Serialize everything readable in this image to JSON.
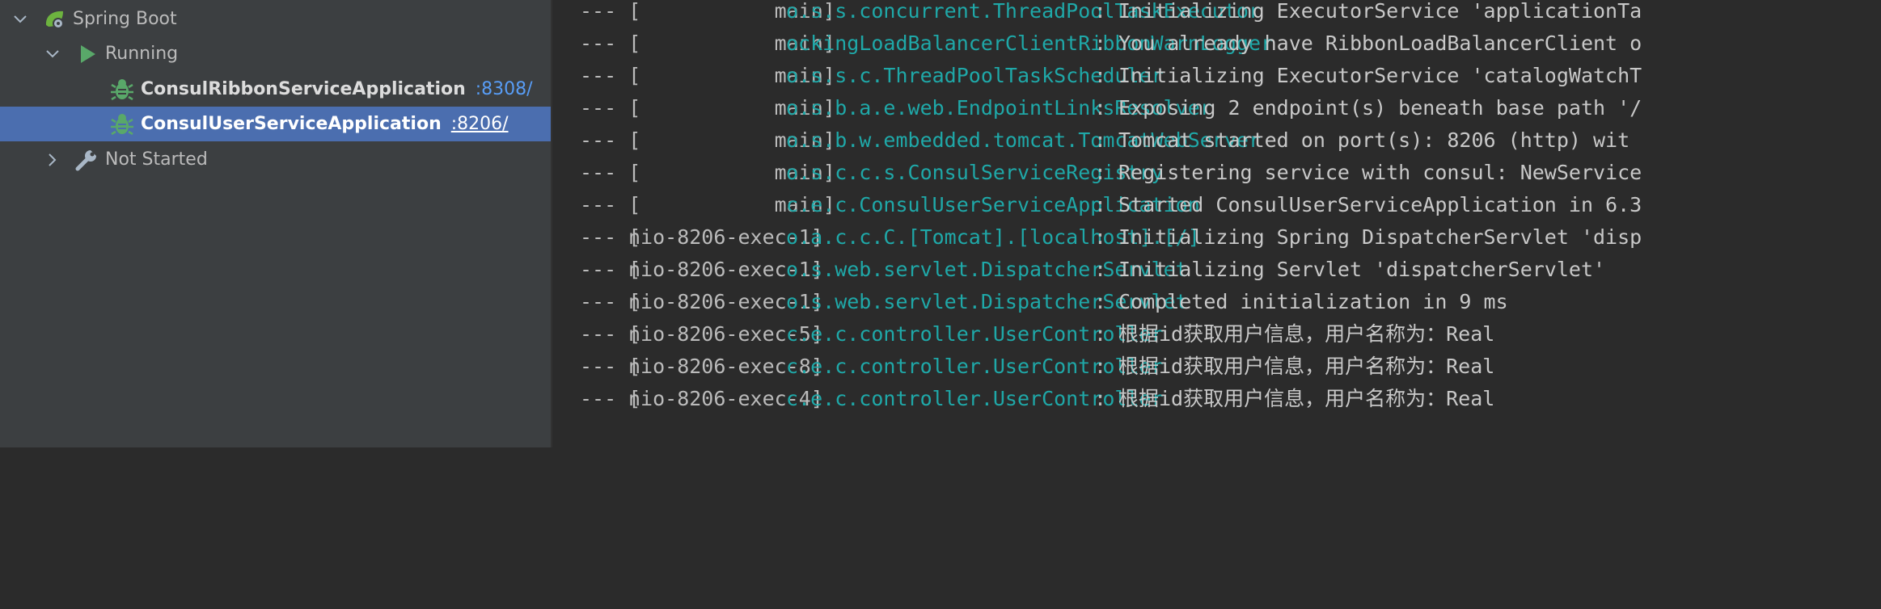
{
  "services_tree": {
    "root": {
      "label": "Spring Boot",
      "expanded": true
    },
    "group_running": {
      "label": "Running",
      "expanded": true
    },
    "apps": [
      {
        "name": "ConsulRibbonServiceApplication",
        "port": ":8308/",
        "selected": false
      },
      {
        "name": "ConsulUserServiceApplication",
        "port": ":8206/",
        "selected": true
      }
    ],
    "group_not_started": {
      "label": "Not Started",
      "expanded": false
    }
  },
  "console": {
    "lines": [
      {
        "prefix": "--- [",
        "thread": "           main]",
        "logger": "o.s.s.concurrent.ThreadPoolTaskExecutor",
        "sep": ":",
        "message": "Initializing ExecutorService 'applicationTa"
      },
      {
        "prefix": "--- [",
        "thread": "           main]",
        "logger": "ockingLoadBalancerClientRibbonWarnLogger",
        "sep": ":",
        "message": "You already have RibbonLoadBalancerClient o"
      },
      {
        "prefix": "--- [",
        "thread": "           main]",
        "logger": "o.s.s.c.ThreadPoolTaskScheduler",
        "sep": ":",
        "message": "Initializing ExecutorService 'catalogWatchT"
      },
      {
        "prefix": "--- [",
        "thread": "           main]",
        "logger": "o.s.b.a.e.web.EndpointLinksResolver",
        "sep": ":",
        "message": "Exposing 2 endpoint(s) beneath base path '/"
      },
      {
        "prefix": "--- [",
        "thread": "           main]",
        "logger": "o.s.b.w.embedded.tomcat.TomcatWebServer",
        "sep": ":",
        "message": "Tomcat started on port(s): 8206 (http) wit"
      },
      {
        "prefix": "--- [",
        "thread": "           main]",
        "logger": "o.s.c.c.s.ConsulServiceRegistry",
        "sep": ":",
        "message": "Registering service with consul: NewService"
      },
      {
        "prefix": "--- [",
        "thread": "           main]",
        "logger": "c.e.c.ConsulUserServiceApplication",
        "sep": ":",
        "message": "Started ConsulUserServiceApplication in 6.3"
      },
      {
        "prefix": "--- [",
        "thread": "nio-8206-exec-1]",
        "logger": "o.a.c.c.C.[Tomcat].[localhost].[/]",
        "sep": ":",
        "message": "Initializing Spring DispatcherServlet 'disp"
      },
      {
        "prefix": "--- [",
        "thread": "nio-8206-exec-1]",
        "logger": "o.s.web.servlet.DispatcherServlet",
        "sep": ":",
        "message": "Initializing Servlet 'dispatcherServlet'"
      },
      {
        "prefix": "--- [",
        "thread": "nio-8206-exec-1]",
        "logger": "o.s.web.servlet.DispatcherServlet",
        "sep": ":",
        "message": "Completed initialization in 9 ms"
      },
      {
        "prefix": "--- [",
        "thread": "nio-8206-exec-5]",
        "logger": "c.e.c.controller.UserController",
        "sep": ":",
        "message": "根据id获取用户信息，用户名称为：Real"
      },
      {
        "prefix": "--- [",
        "thread": "nio-8206-exec-8]",
        "logger": "c.e.c.controller.UserController",
        "sep": ":",
        "message": "根据id获取用户信息，用户名称为：Real"
      },
      {
        "prefix": "--- [",
        "thread": "nio-8206-exec-4]",
        "logger": "c.e.c.controller.UserController",
        "sep": ":",
        "message": "根据id获取用户信息，用户名称为：Real"
      }
    ]
  },
  "colors": {
    "tree_bg": "#3c3f41",
    "console_bg": "#2b2b2b",
    "selection": "#4b6eaf",
    "logger": "#1fa8a8",
    "port_link": "#589df6",
    "run_green": "#59a869"
  }
}
